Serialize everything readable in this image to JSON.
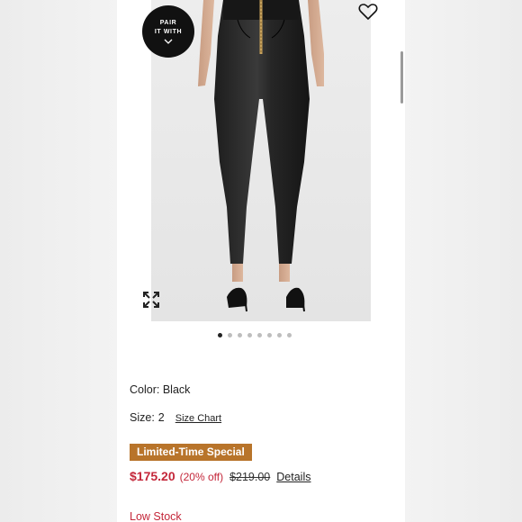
{
  "product": {
    "pair_badge_line1": "PAIR",
    "pair_badge_line2": "IT WITH",
    "color_label": "Color:",
    "color_value": "Black",
    "size_label": "Size:",
    "size_value": "2",
    "size_chart_label": "Size Chart",
    "promo_label": "Limited-Time Special",
    "sale_price": "$175.20",
    "discount": "(20% off)",
    "original_price": "$219.00",
    "details_label": "Details",
    "stock_status": "Low Stock"
  },
  "carousel": {
    "total": 8,
    "active_index": 0
  },
  "icons": {
    "favorite": "heart-icon",
    "expand": "expand-icon",
    "badge": "chevron-down-icon"
  },
  "colors": {
    "price": "#c4273a",
    "promo_bg": "#b8742a",
    "badge_bg": "#111111"
  }
}
